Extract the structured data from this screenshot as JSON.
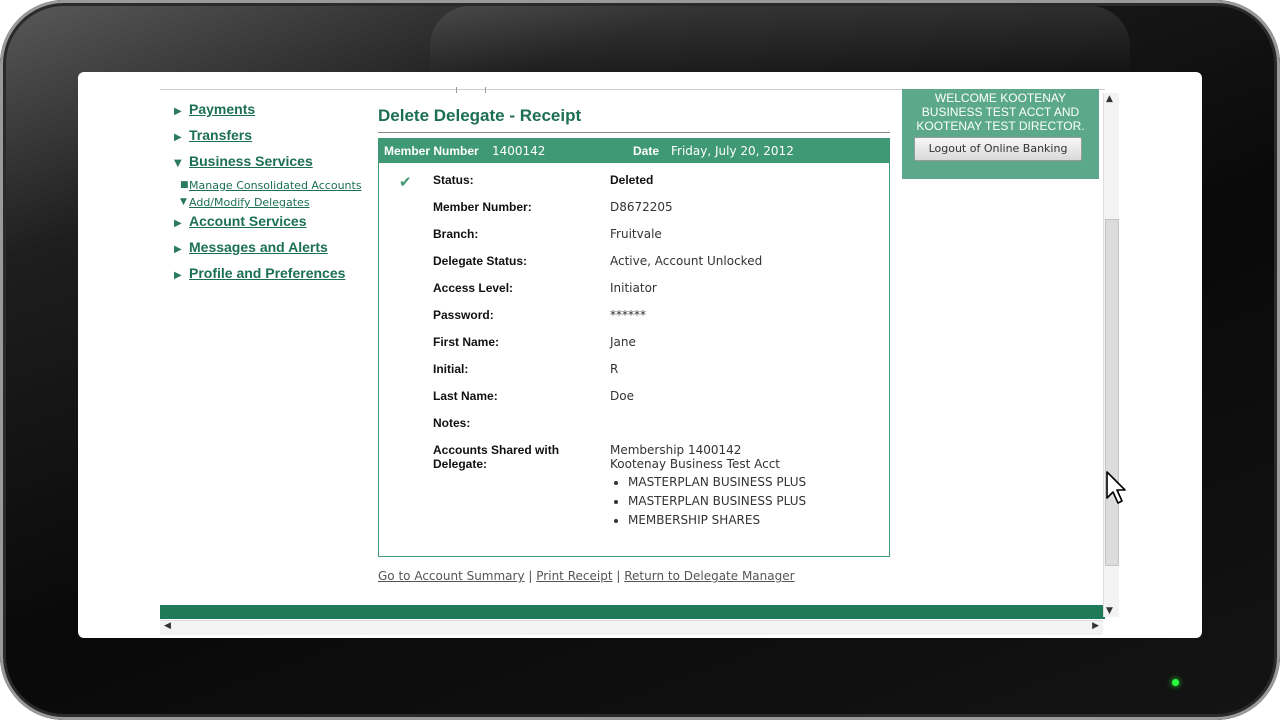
{
  "nav": {
    "items": [
      {
        "label": "Payments"
      },
      {
        "label": "Transfers"
      },
      {
        "label": "Business Services"
      },
      {
        "label": "Account Services"
      },
      {
        "label": "Messages and Alerts"
      },
      {
        "label": "Profile and Preferences"
      }
    ],
    "sub_items": [
      {
        "label": "Manage Consolidated Accounts"
      },
      {
        "label": "Add/Modify Delegates"
      }
    ]
  },
  "main": {
    "title": "Delete Delegate - Receipt",
    "header": {
      "member_label": "Member Number",
      "member_value": "1400142",
      "date_label": "Date",
      "date_value": "Friday, July 20, 2012"
    },
    "fields": [
      {
        "label": "Status:",
        "value": "Deleted"
      },
      {
        "label": "Member Number:",
        "value": "D8672205"
      },
      {
        "label": "Branch:",
        "value": "Fruitvale"
      },
      {
        "label": "Delegate Status:",
        "value": "Active, Account Unlocked"
      },
      {
        "label": "Access Level:",
        "value": "Initiator"
      },
      {
        "label": "Password:",
        "value": "******"
      },
      {
        "label": "First Name:",
        "value": "Jane"
      },
      {
        "label": "Initial:",
        "value": "R"
      },
      {
        "label": "Last Name:",
        "value": "Doe"
      },
      {
        "label": "Notes:",
        "value": ""
      }
    ],
    "shared": {
      "label": "Accounts Shared with Delegate:",
      "membership": "Membership 1400142",
      "account_name": "Kootenay Business Test Acct",
      "accounts": [
        "MASTERPLAN BUSINESS PLUS",
        "MASTERPLAN BUSINESS PLUS",
        "MEMBERSHIP SHARES"
      ]
    },
    "links": {
      "account_summary": "Go to Account Summary",
      "separator": "|",
      "print_receipt": "Print Receipt",
      "delegate_manager": "Return to Delegate Manager"
    }
  },
  "welcome": {
    "text": "WELCOME KOOTENAY BUSINESS TEST ACCT AND KOOTENAY TEST DIRECTOR.",
    "logout_label": "Logout of Online Banking"
  },
  "colors": {
    "brand_green": "#3f9975",
    "link_green": "#1c6f55",
    "footer_green": "#1f7a59"
  }
}
